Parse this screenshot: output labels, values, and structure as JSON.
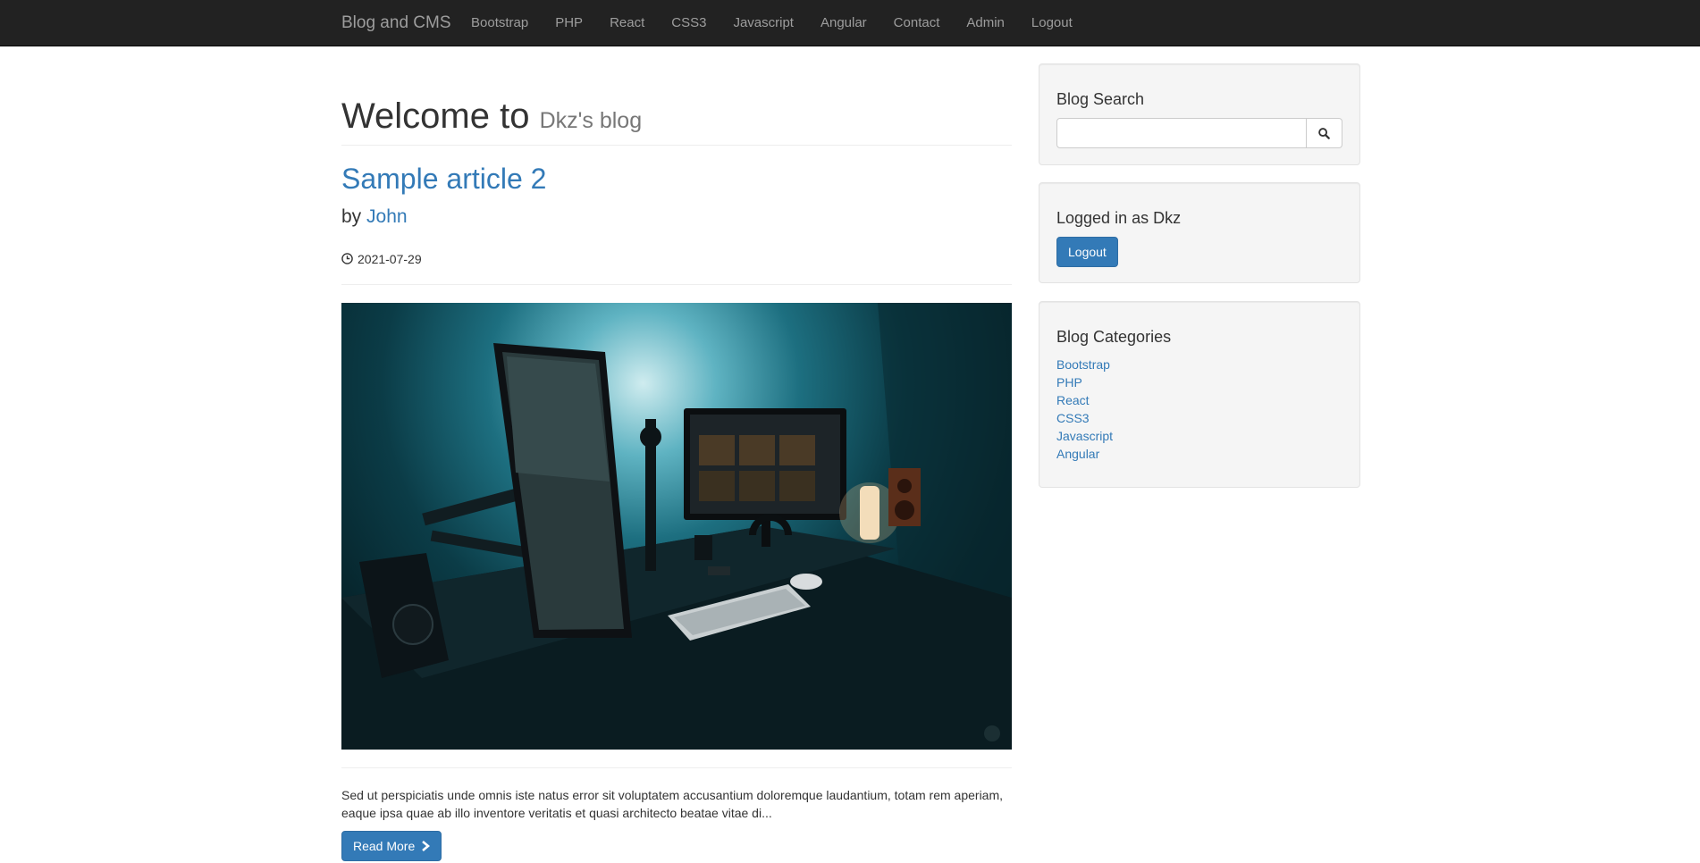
{
  "navbar": {
    "brand": "Blog and CMS",
    "links": [
      "Bootstrap",
      "PHP",
      "React",
      "CSS3",
      "Javascript",
      "Angular",
      "Contact",
      "Admin",
      "Logout"
    ]
  },
  "header": {
    "title": "Welcome to",
    "subtitle": "Dkz's blog"
  },
  "post": {
    "title": "Sample article 2",
    "by_label": "by",
    "author": "John",
    "date": "2021-07-29",
    "excerpt": "Sed ut perspiciatis unde omnis iste natus error sit voluptatem accusantium doloremque laudantium, totam rem aperiam, eaque ipsa quae ab illo inventore veritatis et quasi architecto beatae vitae di...",
    "read_more": "Read More"
  },
  "sidebar": {
    "search": {
      "title": "Blog Search",
      "placeholder": ""
    },
    "login": {
      "title": "Logged in as Dkz",
      "logout": "Logout"
    },
    "categories": {
      "title": "Blog Categories",
      "items": [
        "Bootstrap",
        "PHP",
        "React",
        "CSS3",
        "Javascript",
        "Angular"
      ]
    }
  },
  "colors": {
    "navbar": "#222222",
    "link": "#337ab7",
    "primary_button": "#337ab7",
    "well": "#f5f5f5"
  }
}
